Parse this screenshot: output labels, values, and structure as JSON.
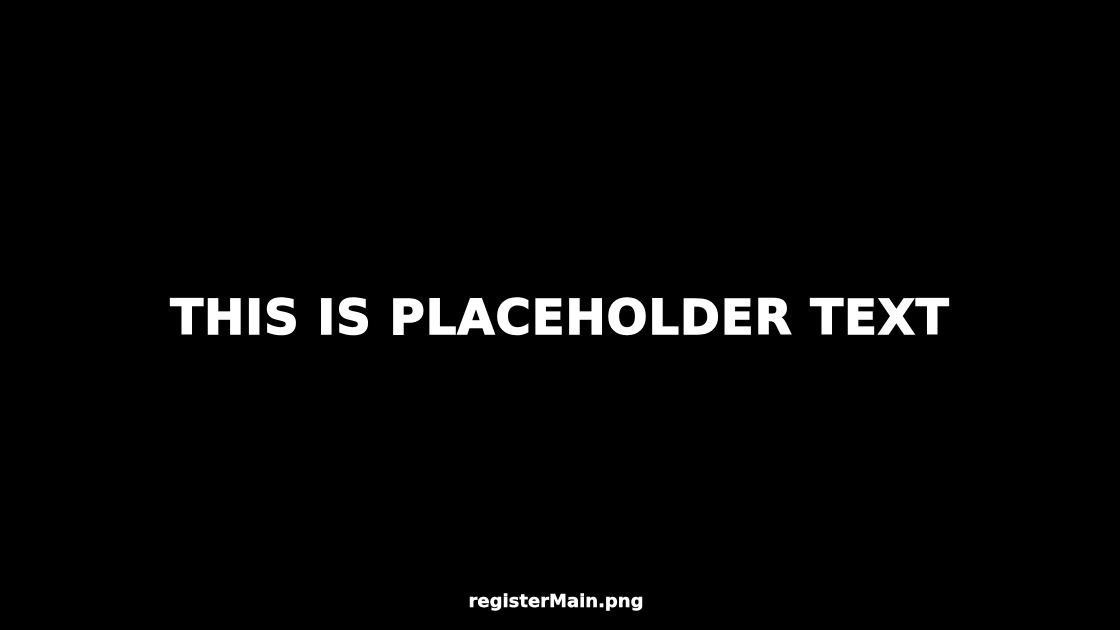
{
  "placeholder": {
    "headline": "THIS IS PLACEHOLDER TEXT",
    "filename": "registerMain.png"
  },
  "colors": {
    "background": "#000000",
    "text": "#ffffff"
  }
}
